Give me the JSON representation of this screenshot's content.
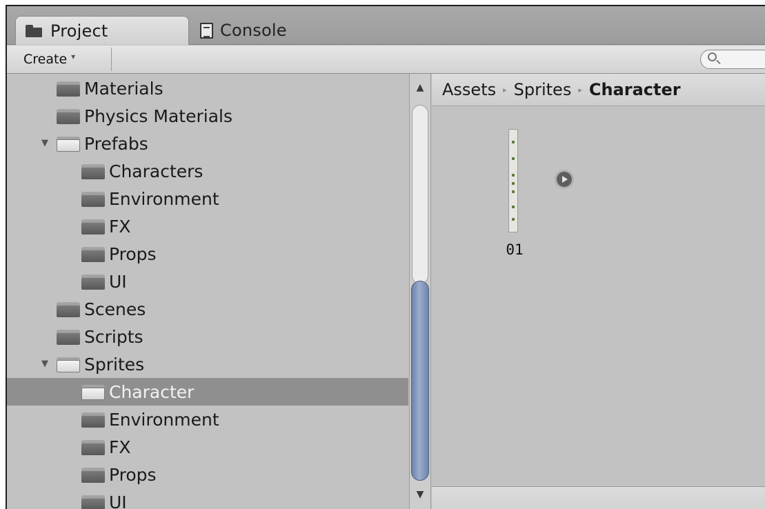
{
  "tabs": [
    {
      "label": "Project",
      "icon": "folder-icon",
      "active": true
    },
    {
      "label": "Console",
      "icon": "console-icon",
      "active": false
    }
  ],
  "toolbar": {
    "create_label": "Create",
    "create_arrow": "▾"
  },
  "tree": [
    {
      "label": "Materials",
      "depth": 1,
      "expanded": false
    },
    {
      "label": "Physics Materials",
      "depth": 1,
      "expanded": false
    },
    {
      "label": "Prefabs",
      "depth": 1,
      "expanded": true
    },
    {
      "label": "Characters",
      "depth": 2,
      "expanded": false
    },
    {
      "label": "Environment",
      "depth": 2,
      "expanded": false
    },
    {
      "label": "FX",
      "depth": 2,
      "expanded": false
    },
    {
      "label": "Props",
      "depth": 2,
      "expanded": false
    },
    {
      "label": "UI",
      "depth": 2,
      "expanded": false
    },
    {
      "label": "Scenes",
      "depth": 1,
      "expanded": false
    },
    {
      "label": "Scripts",
      "depth": 1,
      "expanded": false
    },
    {
      "label": "Sprites",
      "depth": 1,
      "expanded": true
    },
    {
      "label": "Character",
      "depth": 2,
      "expanded": false,
      "selected": true
    },
    {
      "label": "Environment",
      "depth": 2,
      "expanded": false
    },
    {
      "label": "FX",
      "depth": 2,
      "expanded": false
    },
    {
      "label": "Props",
      "depth": 2,
      "expanded": false
    },
    {
      "label": "UI",
      "depth": 2,
      "expanded": false
    }
  ],
  "breadcrumb": {
    "items": [
      "Assets",
      "Sprites"
    ],
    "current": "Character",
    "separator": "▸"
  },
  "asset": {
    "label": "01"
  },
  "scroll": {
    "up": "▲",
    "down": "▼"
  },
  "colors": {
    "selection": "#8f8f8f",
    "scroll_thumb": "#8799bd",
    "panel_bg": "#c2c2c2"
  }
}
